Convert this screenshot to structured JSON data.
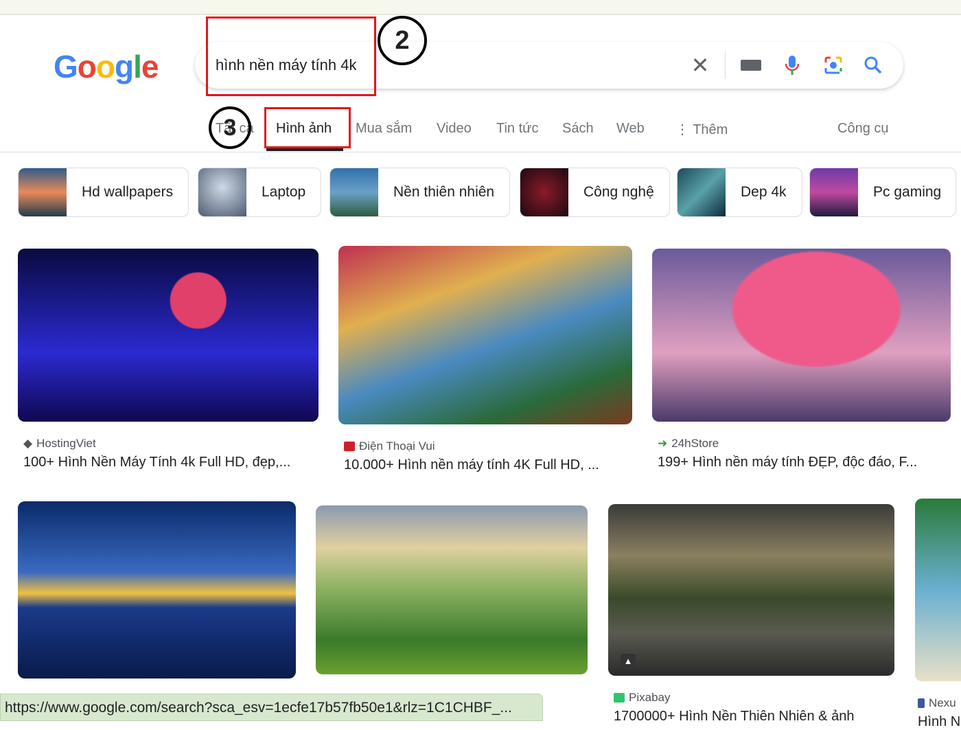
{
  "logo": "Google",
  "search": {
    "query": "hình nền máy tính 4k",
    "icons": [
      "close-icon",
      "keyboard-icon",
      "mic-icon",
      "lens-icon",
      "search-icon"
    ]
  },
  "annotations": {
    "step2": "2",
    "step3": "3"
  },
  "tabs": [
    {
      "label": "Tất cả"
    },
    {
      "label": "Hình ảnh",
      "active": true
    },
    {
      "label": "Mua sắm"
    },
    {
      "label": "Video"
    },
    {
      "label": "Tin tức"
    },
    {
      "label": "Sách"
    },
    {
      "label": "Web"
    },
    {
      "label": "Thêm"
    }
  ],
  "tools": "Công cụ",
  "chips": [
    {
      "label": "Hd wallpapers"
    },
    {
      "label": "Laptop"
    },
    {
      "label": "Nền thiên nhiên"
    },
    {
      "label": "Công nghệ"
    },
    {
      "label": "Dep 4k"
    },
    {
      "label": "Pc gaming"
    }
  ],
  "results": [
    {
      "source": "HostingViet",
      "title": "100+ Hình Nền Máy Tính 4k Full HD, đẹp,..."
    },
    {
      "source": "Điện Thoại Vui",
      "title": "10.000+ Hình nền máy tính 4K Full HD, ..."
    },
    {
      "source": "24hStore",
      "title": "199+ Hình nền máy tính ĐẸP, độc đáo, F..."
    },
    {
      "source": "Pixabay",
      "title": "1700000+ Hình Nền Thiên Nhiên & ảnh"
    },
    {
      "source": "Nexu",
      "title": "Hình N"
    }
  ],
  "status_url": "https://www.google.com/search?sca_esv=1ecfe17b57fb50e1&rlz=1C1CHBF_..."
}
